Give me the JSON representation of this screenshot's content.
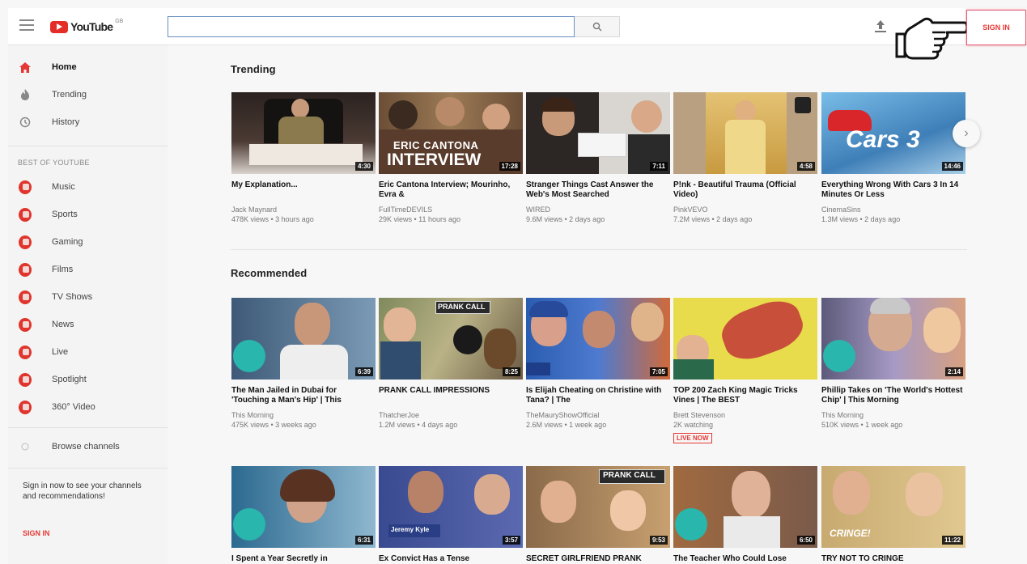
{
  "header": {
    "logo_text": "YouTube",
    "logo_region": "GB",
    "search_placeholder": "",
    "search_icon": "search-icon",
    "upload_icon": "upload-icon",
    "sign_in_label": "SIGN IN"
  },
  "sidebar": {
    "main_items": [
      {
        "label": "Home",
        "icon": "home-icon",
        "active": true
      },
      {
        "label": "Trending",
        "icon": "fire-icon",
        "active": false
      },
      {
        "label": "History",
        "icon": "history-icon",
        "active": false
      }
    ],
    "best_of_title": "BEST OF YOUTUBE",
    "best_items": [
      {
        "label": "Music",
        "icon": "music-icon"
      },
      {
        "label": "Sports",
        "icon": "sports-icon"
      },
      {
        "label": "Gaming",
        "icon": "gaming-icon"
      },
      {
        "label": "Films",
        "icon": "films-icon"
      },
      {
        "label": "TV Shows",
        "icon": "tv-icon"
      },
      {
        "label": "News",
        "icon": "news-icon"
      },
      {
        "label": "Live",
        "icon": "live-icon"
      },
      {
        "label": "Spotlight",
        "icon": "spotlight-icon"
      },
      {
        "label": "360° Video",
        "icon": "360-video-icon"
      }
    ],
    "browse_channels": "Browse channels",
    "signin_prompt": "Sign in now to see your channels and recommendations!",
    "signin_link": "SIGN IN"
  },
  "trending": {
    "heading": "Trending",
    "videos": [
      {
        "title": "My Explanation...",
        "channel": "Jack Maynard",
        "meta": "478K views • 3 hours ago",
        "duration": "4:30"
      },
      {
        "title": "Eric Cantona Interview; Mourinho, Evra &",
        "channel": "FullTimeDEVILS",
        "meta": "29K views • 11 hours ago",
        "duration": "17:28"
      },
      {
        "title": "Stranger Things Cast Answer the Web's Most Searched",
        "channel": "WIRED",
        "meta": "9.6M views • 2 days ago",
        "duration": "7:11"
      },
      {
        "title": "P!nk - Beautiful Trauma (Official Video)",
        "channel": "PinkVEVO",
        "meta": "7.2M views • 2 days ago",
        "duration": "4:58"
      },
      {
        "title": "Everything Wrong With Cars 3 In 14 Minutes Or Less",
        "channel": "CinemaSins",
        "meta": "1.3M views • 2 days ago",
        "duration": "14:46"
      }
    ]
  },
  "recommended": {
    "heading": "Recommended",
    "row1": [
      {
        "title": "The Man Jailed in Dubai for 'Touching a Man's Hip' | This",
        "channel": "This Morning",
        "meta": "475K views • 3 weeks ago",
        "duration": "6:39",
        "live": ""
      },
      {
        "title": "PRANK CALL IMPRESSIONS",
        "channel": "ThatcherJoe",
        "meta": "1.2M views • 4 days ago",
        "duration": "8:25",
        "live": ""
      },
      {
        "title": "Is Elijah Cheating on Christine with Tana? | The",
        "channel": "TheMauryShowOfficial",
        "meta": "2.6M views • 1 week ago",
        "duration": "7:05",
        "live": ""
      },
      {
        "title": "TOP 200 Zach King Magic Tricks Vines | The BEST",
        "channel": "Brett Stevenson",
        "meta": "2K watching",
        "duration": "",
        "live": "LIVE NOW"
      },
      {
        "title": "Phillip Takes on 'The World's Hottest Chip' | This Morning",
        "channel": "This Morning",
        "meta": "510K views • 1 week ago",
        "duration": "2:14",
        "live": ""
      }
    ],
    "row2": [
      {
        "title": "I Spent a Year Secretly in",
        "duration": "6:31"
      },
      {
        "title": "Ex Convict Has a Tense",
        "duration": "3:57"
      },
      {
        "title": "SECRET GIRLFRIEND PRANK",
        "duration": "9:53"
      },
      {
        "title": "The Teacher Who Could Lose",
        "duration": "6:50"
      },
      {
        "title": "TRY NOT TO CRINGE",
        "duration": "11:22"
      }
    ]
  },
  "thumb_texts": {
    "cantona": "ERIC CANTONA",
    "interview": "INTERVIEW",
    "cars": "Cars 3",
    "prank1": "PRANK CALL",
    "prank2": "PRANK CALL",
    "cringe": "CRINGE!",
    "kyle": "Jeremy Kyle"
  },
  "colors": {
    "accent": "#e53935",
    "brand": "#e52d27"
  }
}
